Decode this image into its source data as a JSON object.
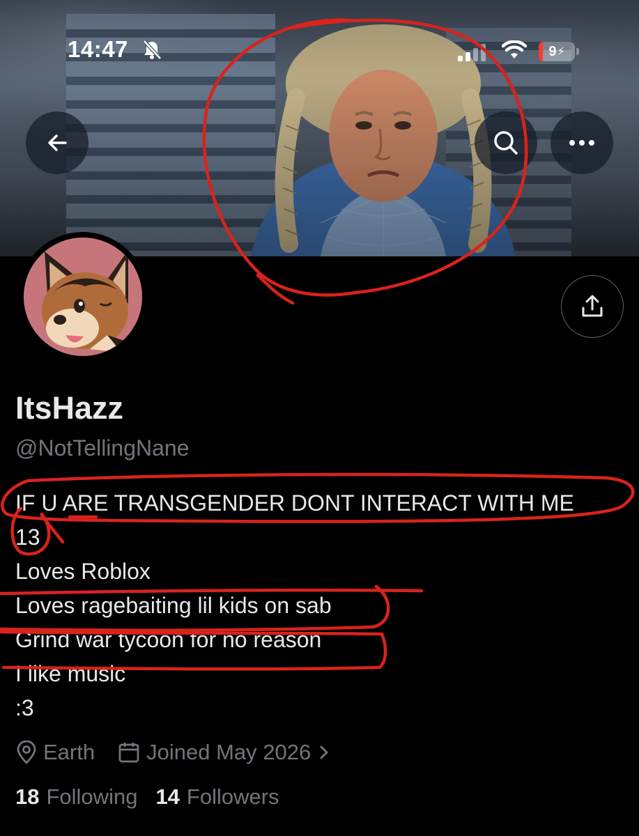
{
  "status_bar": {
    "time": "14:47",
    "battery": "9"
  },
  "banner": {
    "image_description_icon": "banner-image"
  },
  "nav": {
    "back_icon": "arrow-left-icon",
    "search_icon": "search-icon",
    "more_icon": "more-horizontal-icon",
    "share_icon": "share-icon"
  },
  "profile": {
    "display_name": "ItsHazz",
    "handle": "@NotTellingNane",
    "bio_lines": [
      "IF U ARE TRANSGENDER DONT INTERACT WITH ME",
      "13",
      "Loves Roblox",
      "Loves ragebaiting lil kids on sab",
      "Grind war tycoon for no reason",
      "I like music",
      ":3"
    ],
    "location": "Earth",
    "joined": "Joined May 2026",
    "following_count": "18",
    "following_label": "Following",
    "followers_count": "14",
    "followers_label": "Followers"
  },
  "colors": {
    "background": "#000000",
    "primary_text": "#e7e9ea",
    "secondary_text": "#71767b",
    "annotation_red": "#d9231b"
  }
}
